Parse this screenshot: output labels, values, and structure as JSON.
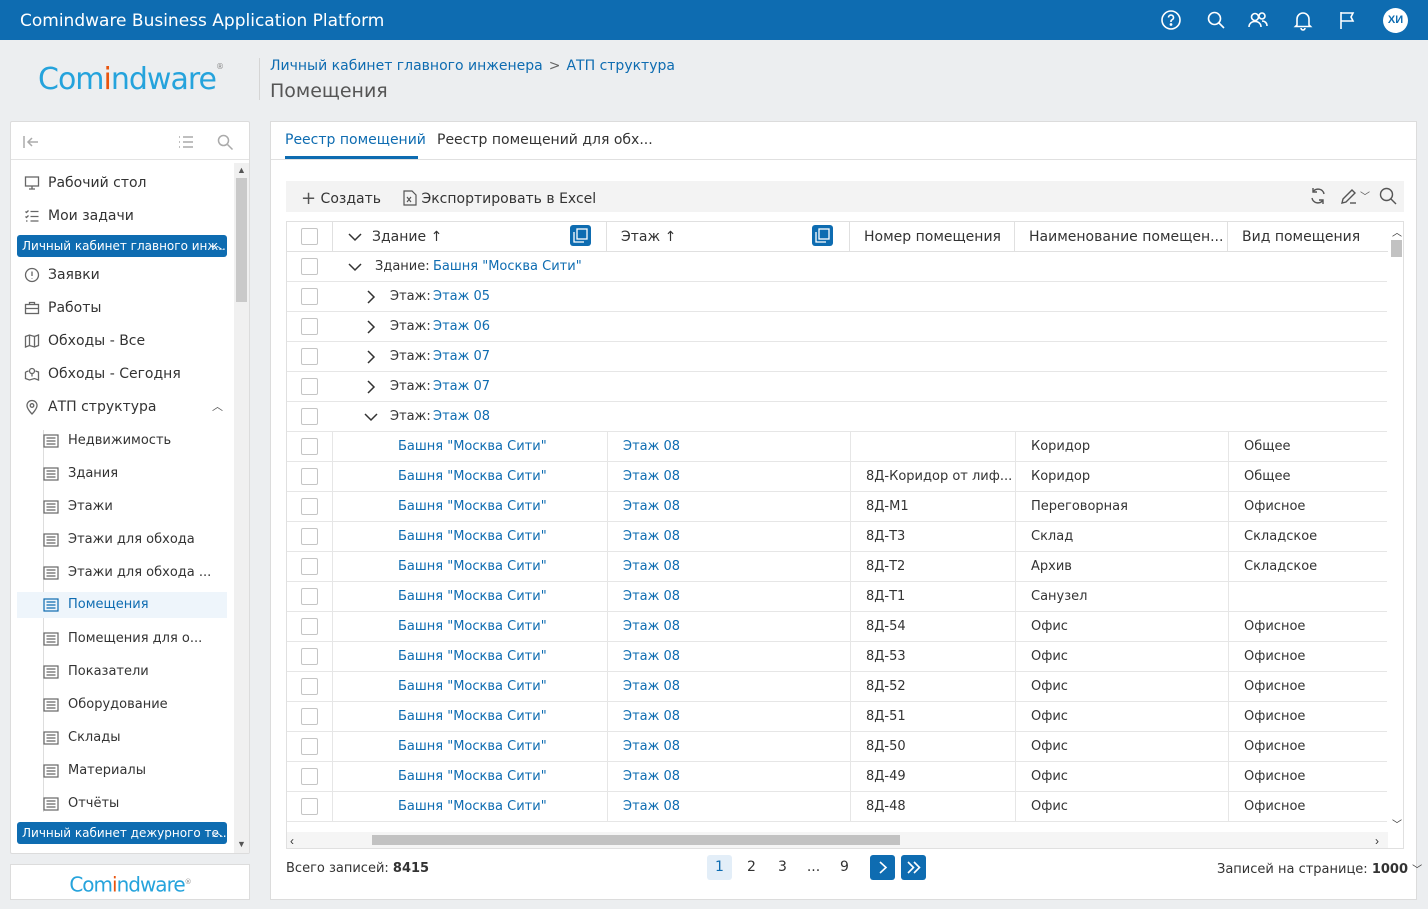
{
  "app": {
    "title": "Comindware Business Application Platform",
    "avatar": "ХИ"
  },
  "logo": {
    "part1": "Com",
    "part2": "i",
    "part3": "ndware",
    "reg": "®"
  },
  "breadcrumb": {
    "parent": "Личный кабинет главного инженера",
    "current": "АТП структура",
    "separator": ">"
  },
  "page_title": "Помещения",
  "sidebar": {
    "items": [
      {
        "label": "Рабочий стол",
        "icon": "desktop-icon"
      },
      {
        "label": "Мои задачи",
        "icon": "checklist-icon"
      }
    ],
    "group1": "Личный кабинет главного инж...",
    "items2": [
      {
        "label": "Заявки",
        "icon": "alert-circle-icon"
      },
      {
        "label": "Работы",
        "icon": "briefcase-icon"
      },
      {
        "label": "Обходы - Все",
        "icon": "map-icon"
      },
      {
        "label": "Обходы - Сегодня",
        "icon": "map-pin-route-icon"
      },
      {
        "label": "АТП структура",
        "icon": "location-pin-icon"
      }
    ],
    "sub_items": [
      "Недвижимость",
      "Здания",
      "Этажи",
      "Этажи для обхода",
      "Этажи для обхода ...",
      "Помещения",
      "Помещения для о...",
      "Показатели",
      "Оборудование",
      "Склады",
      "Материалы",
      "Отчёты"
    ],
    "group2": "Личный кабинет дежурного те..."
  },
  "tabs": [
    "Реестр помещений",
    "Реестр помещений для обх..."
  ],
  "toolbar": {
    "create": "Создать",
    "export": "Экспортировать в Excel"
  },
  "grid": {
    "columns": [
      "Здание",
      "Этаж",
      "Номер помещения",
      "Наименование помещен...",
      "Вид помещения"
    ],
    "sort_arrow": "↑",
    "group_building": {
      "label": "Здание:",
      "value": "Башня \"Москва Сити\""
    },
    "floor_label": "Этаж:",
    "floors_collapsed": [
      "Этаж 05",
      "Этаж 06",
      "Этаж 07",
      "Этаж 07"
    ],
    "floor_expanded": "Этаж 08",
    "rows": [
      {
        "building": "Башня \"Москва Сити\"",
        "floor": "Этаж 08",
        "number": "",
        "name": "Коридор",
        "type": "Общее"
      },
      {
        "building": "Башня \"Москва Сити\"",
        "floor": "Этаж 08",
        "number": "8Д-Коридор от лиф...",
        "name": "Коридор",
        "type": "Общее"
      },
      {
        "building": "Башня \"Москва Сити\"",
        "floor": "Этаж 08",
        "number": "8Д-М1",
        "name": "Переговорная",
        "type": "Офисное"
      },
      {
        "building": "Башня \"Москва Сити\"",
        "floor": "Этаж 08",
        "number": "8Д-Т3",
        "name": "Склад",
        "type": "Складское"
      },
      {
        "building": "Башня \"Москва Сити\"",
        "floor": "Этаж 08",
        "number": "8Д-Т2",
        "name": "Архив",
        "type": "Складское"
      },
      {
        "building": "Башня \"Москва Сити\"",
        "floor": "Этаж 08",
        "number": "8Д-Т1",
        "name": "Санузел",
        "type": ""
      },
      {
        "building": "Башня \"Москва Сити\"",
        "floor": "Этаж 08",
        "number": "8Д-54",
        "name": "Офис",
        "type": "Офисное"
      },
      {
        "building": "Башня \"Москва Сити\"",
        "floor": "Этаж 08",
        "number": "8Д-53",
        "name": "Офис",
        "type": "Офисное"
      },
      {
        "building": "Башня \"Москва Сити\"",
        "floor": "Этаж 08",
        "number": "8Д-52",
        "name": "Офис",
        "type": "Офисное"
      },
      {
        "building": "Башня \"Москва Сити\"",
        "floor": "Этаж 08",
        "number": "8Д-51",
        "name": "Офис",
        "type": "Офисное"
      },
      {
        "building": "Башня \"Москва Сити\"",
        "floor": "Этаж 08",
        "number": "8Д-50",
        "name": "Офис",
        "type": "Офисное"
      },
      {
        "building": "Башня \"Москва Сити\"",
        "floor": "Этаж 08",
        "number": "8Д-49",
        "name": "Офис",
        "type": "Офисное"
      },
      {
        "building": "Башня \"Москва Сити\"",
        "floor": "Этаж 08",
        "number": "8Д-48",
        "name": "Офис",
        "type": "Офисное"
      }
    ]
  },
  "footer": {
    "total_label": "Всего записей:",
    "total_value": "8415",
    "pages": [
      "1",
      "2",
      "3",
      "...",
      "9"
    ],
    "per_page_label": "Записей на странице:",
    "per_page_value": "1000"
  },
  "colors": {
    "accent": "#0e6cb1",
    "logo_blue": "#25a3dc",
    "logo_orange": "#e9540d"
  }
}
